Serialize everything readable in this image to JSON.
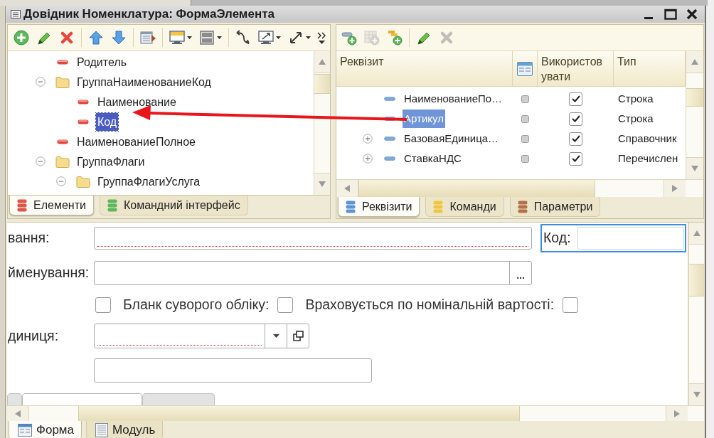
{
  "window": {
    "title": "Довідник Номенклатура: ФормаЭлемента"
  },
  "elements_panel": {
    "toolbar": [
      {
        "buttons": [
          {
            "kind": "add",
            "disabled": false,
            "dropdown": false
          },
          {
            "kind": "edit",
            "disabled": false,
            "dropdown": false
          },
          {
            "kind": "delete",
            "disabled": false,
            "dropdown": false
          }
        ]
      },
      {
        "buttons": [
          {
            "kind": "move_up",
            "disabled": false,
            "dropdown": false
          },
          {
            "kind": "move_down",
            "disabled": false,
            "dropdown": false
          }
        ]
      },
      {
        "buttons": [
          {
            "kind": "form_list",
            "disabled": false,
            "dropdown": false
          }
        ]
      },
      {
        "buttons": [
          {
            "kind": "monitor",
            "disabled": false,
            "dropdown": true
          },
          {
            "kind": "panel",
            "disabled": false,
            "dropdown": true
          }
        ]
      },
      {
        "buttons": [
          {
            "kind": "curved_arrow",
            "disabled": false,
            "dropdown": false
          },
          {
            "kind": "resize_monitor",
            "disabled": false,
            "dropdown": true
          },
          {
            "kind": "diagonal_arrows",
            "disabled": false,
            "dropdown": true
          }
        ]
      }
    ],
    "tree": [
      {
        "label": "Родитель",
        "kind": "field",
        "selected": false
      },
      {
        "label": "ГруппаНаименованиеКод",
        "kind": "group",
        "expanded": true,
        "selected": false,
        "children": [
          {
            "label": "Наименование",
            "kind": "field",
            "selected": false
          },
          {
            "label": "Код",
            "kind": "field",
            "selected": true
          }
        ]
      },
      {
        "label": "НаименованиеПолное",
        "kind": "field",
        "selected": false
      },
      {
        "label": "ГруппаФлаги",
        "kind": "group",
        "expanded": true,
        "selected": false,
        "children": [
          {
            "label": "ГруппаФлагиУслуга",
            "kind": "group",
            "expanded": true,
            "selected": false
          }
        ]
      }
    ],
    "tabs": [
      {
        "label": "Елементи",
        "selected": true,
        "color": "#e05548"
      },
      {
        "label": "Командний інтерфейс",
        "selected": false,
        "color": "#5cb85c"
      }
    ]
  },
  "attributes_panel": {
    "toolbar": [
      {
        "buttons": [
          {
            "kind": "add_attribute",
            "disabled": false,
            "dropdown": false
          },
          {
            "kind": "add_table",
            "disabled": true,
            "dropdown": false
          },
          {
            "kind": "add_group",
            "disabled": false,
            "dropdown": false
          }
        ]
      },
      {
        "buttons": [
          {
            "kind": "edit",
            "disabled": false,
            "dropdown": false
          },
          {
            "kind": "delete",
            "disabled": true,
            "dropdown": false
          }
        ]
      }
    ],
    "columns": [
      {
        "kind": "text",
        "label": "Реквізит"
      },
      {
        "kind": "icon"
      },
      {
        "kind": "text",
        "label": "Використовувати"
      },
      {
        "kind": "text",
        "label": "Тип"
      }
    ],
    "rows": [
      {
        "name": "НаименованиеПо…",
        "expandable": false,
        "used": true,
        "type": "Строка",
        "selected": false
      },
      {
        "name": "Артикул",
        "expandable": false,
        "used": true,
        "type": "Строка",
        "selected": true
      },
      {
        "name": "БазоваяЕдиница…",
        "expandable": true,
        "used": true,
        "type": "Справочник",
        "selected": false
      },
      {
        "name": "СтавкаНДС",
        "expandable": true,
        "used": true,
        "type": "Перечислен",
        "selected": false
      }
    ],
    "tabs": [
      {
        "label": "Реквізити",
        "selected": true,
        "color": "#5d94d6"
      },
      {
        "label": "Команди",
        "selected": false,
        "color": "#f0c640"
      },
      {
        "label": "Параметри",
        "selected": false,
        "color": "#b5714a"
      }
    ]
  },
  "form_preview": {
    "rows": [
      {
        "kind": "text",
        "label": "вання:",
        "required": true,
        "side_field": {
          "label": "Код:",
          "focused": true,
          "required": false
        }
      },
      {
        "kind": "text_with_button",
        "label": "йменування:",
        "required": false,
        "button": "..."
      },
      {
        "kind": "checkboxes",
        "items": [
          {
            "checked": false
          },
          {
            "label": "Бланк суворого обліку:",
            "checked": false
          },
          {
            "label": "Враховується по номінальній вартості:",
            "checked": false
          }
        ]
      },
      {
        "kind": "combo",
        "label": "диниця:",
        "required": true
      },
      {
        "kind": "text_short",
        "required": false
      }
    ],
    "tabs": [
      {
        "selected": false
      },
      {
        "selected": true
      },
      {
        "selected": false
      }
    ]
  },
  "bottom_tabs": [
    {
      "label": "Форма",
      "kind": "form",
      "selected": true
    },
    {
      "label": "Модуль",
      "kind": "module",
      "selected": false
    }
  ]
}
